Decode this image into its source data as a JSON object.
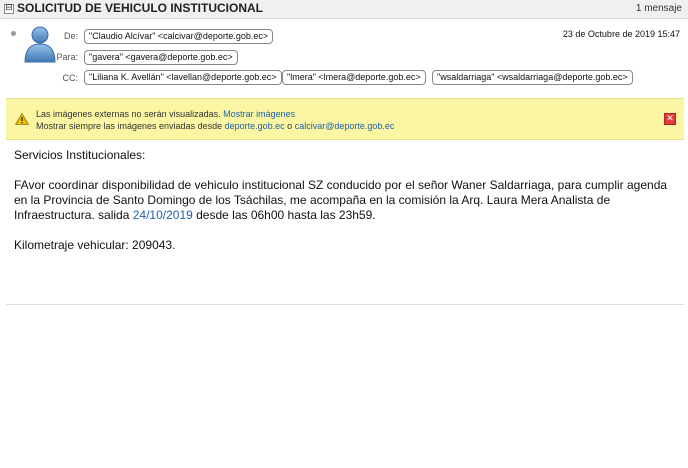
{
  "header": {
    "collapse_glyph": "⊟",
    "subject": "SOLICITUD DE VEHICULO INSTITUCIONAL",
    "message_count": "1 mensaje"
  },
  "message": {
    "from_label": "De:",
    "from": "\"Claudio Alcívar\" <calcivar@deporte.gob.ec>",
    "to_label": "Para:",
    "to": "\"gavera\" <gavera@deporte.gob.ec>",
    "cc_label": "CC:",
    "cc": [
      "\"Liliana K. Avellán\" <lavellan@deporte.gob.ec>",
      "\"lmera\" <lmera@deporte.gob.ec>",
      "\"wsaldarriaga\" <wsaldarriaga@deporte.gob.ec>"
    ],
    "date": "23 de Octubre de 2019 15:47"
  },
  "notice": {
    "icon": "warning-icon",
    "line1_text": "Las imágenes externas no serán visualizadas.",
    "show_images_link": "Mostrar imágenes",
    "line2_text": "Mostrar siempre las imágenes enviadas desde",
    "domain_link": "deporte.gob.ec",
    "or_text": "o",
    "sender_link": "calcivar@deporte.gob.ec",
    "close_glyph": "✕"
  },
  "body": {
    "greeting": "Servicios Institucionales:",
    "paragraph_before_date": "FAvor coordinar disponibilidad de vehiculo institucional SZ conducido por el señor Waner Saldarriaga, para cumplir agenda en la Provincia de Santo Domingo de los Tsáchilas,  me acompaña en la comisión la Arq. Laura Mera Analista de Infraestructura. salida ",
    "date_link": "24/10/2019",
    "paragraph_after_date": " desde las 06h00 hasta  las 23h59.",
    "mileage": "Kilometraje vehicular: 209043."
  },
  "colors": {
    "notice_bg": "#fbf6a4",
    "link": "#1f5fa8",
    "close_red": "#e23b3b"
  }
}
